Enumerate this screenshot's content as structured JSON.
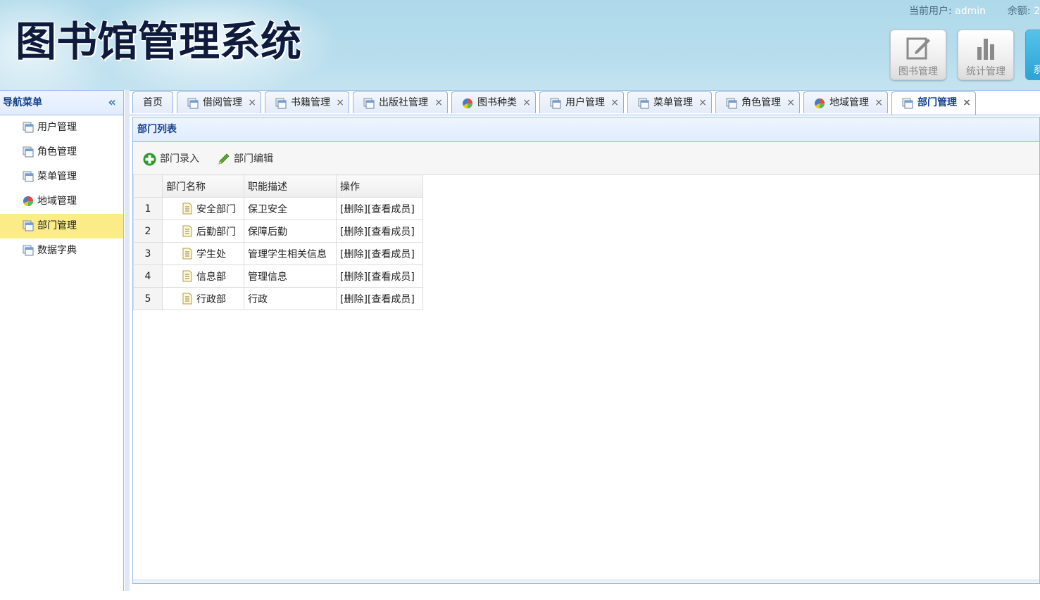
{
  "header": {
    "title": "图书馆管理系统",
    "current_user_label": "当前用户:",
    "current_user": "admin",
    "balance_label": "余额:",
    "balance_value": "2",
    "buttons": [
      {
        "label": "图书管理",
        "icon": "edit-icon"
      },
      {
        "label": "统计管理",
        "icon": "bar-chart-icon"
      },
      {
        "label": "系",
        "icon": "system-icon"
      }
    ]
  },
  "sidebar": {
    "title": "导航菜单",
    "collapse_glyph": "«",
    "items": [
      {
        "label": "用户管理",
        "icon": "window-icon",
        "active": false
      },
      {
        "label": "角色管理",
        "icon": "window-icon",
        "active": false
      },
      {
        "label": "菜单管理",
        "icon": "window-icon",
        "active": false
      },
      {
        "label": "地域管理",
        "icon": "pie-chart-icon",
        "active": false
      },
      {
        "label": "部门管理",
        "icon": "window-icon",
        "active": true
      },
      {
        "label": "数据字典",
        "icon": "window-icon",
        "active": false
      }
    ]
  },
  "tabs": [
    {
      "label": "首页",
      "icon": "",
      "closable": false
    },
    {
      "label": "借阅管理",
      "icon": "window-icon",
      "closable": true
    },
    {
      "label": "书籍管理",
      "icon": "window-icon",
      "closable": true
    },
    {
      "label": "出版社管理",
      "icon": "window-icon",
      "closable": true
    },
    {
      "label": "图书种类",
      "icon": "pie-chart-icon",
      "closable": true
    },
    {
      "label": "用户管理",
      "icon": "window-icon",
      "closable": true
    },
    {
      "label": "菜单管理",
      "icon": "window-icon",
      "closable": true
    },
    {
      "label": "角色管理",
      "icon": "window-icon",
      "closable": true
    },
    {
      "label": "地域管理",
      "icon": "pie-chart-icon",
      "closable": true
    },
    {
      "label": "部门管理",
      "icon": "window-icon",
      "closable": true,
      "active": true
    }
  ],
  "tab_close_glyph": "×",
  "panel": {
    "title": "部门列表",
    "toolbar": {
      "add_label": "部门录入",
      "edit_label": "部门编辑"
    },
    "grid": {
      "columns": [
        "部门名称",
        "职能描述",
        "操作"
      ],
      "rows": [
        {
          "n": "1",
          "name": "安全部门",
          "desc": "保卫安全",
          "op_delete": "[删除]",
          "op_view": "[查看成员]"
        },
        {
          "n": "2",
          "name": "后勤部门",
          "desc": "保障后勤",
          "op_delete": "[删除]",
          "op_view": "[查看成员]"
        },
        {
          "n": "3",
          "name": "学生处",
          "desc": "管理学生相关信息",
          "op_delete": "[删除]",
          "op_view": "[查看成员]"
        },
        {
          "n": "4",
          "name": "信息部",
          "desc": "管理信息",
          "op_delete": "[删除]",
          "op_view": "[查看成员]"
        },
        {
          "n": "5",
          "name": "行政部",
          "desc": "行政",
          "op_delete": "[删除]",
          "op_view": "[查看成员]"
        }
      ]
    }
  },
  "colors": {
    "header_bg": "#aed9ea",
    "title_color": "#0e1b3d",
    "panel_border": "#99bbe8",
    "panel_title": "#15428b",
    "active_nav": "#fbec88",
    "add_icon_green": "#2e9b2e"
  }
}
